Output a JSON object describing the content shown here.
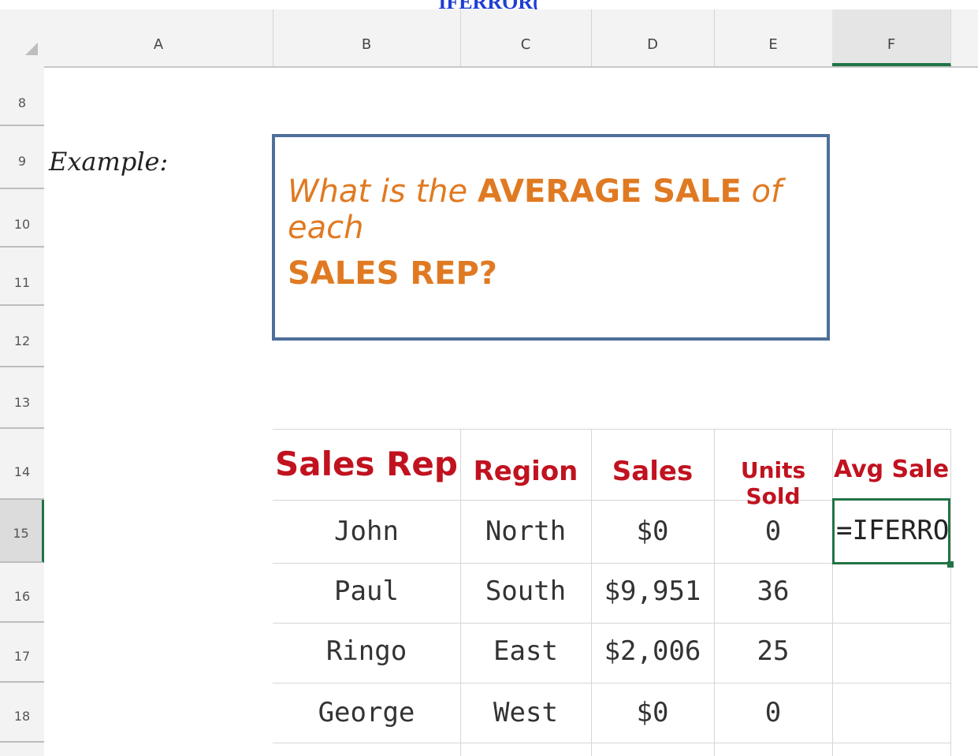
{
  "formula_overlay": "IFERROR(",
  "columns": [
    "A",
    "B",
    "C",
    "D",
    "E",
    "F"
  ],
  "rows": [
    "8",
    "9",
    "10",
    "11",
    "12",
    "13",
    "14",
    "15",
    "16",
    "17",
    "18"
  ],
  "example_label": "Example:",
  "question": {
    "line1_prefix": "What is the ",
    "line1_bold": "AVERAGE SALE",
    "line1_suffix": " of each",
    "line2_bold": "SALES REP?"
  },
  "table": {
    "headers": [
      "Sales Rep",
      "Region",
      "Sales",
      "Units Sold",
      "Avg Sale"
    ],
    "rows": [
      [
        "John",
        "North",
        "$0",
        "0"
      ],
      [
        "Paul",
        "South",
        "$9,951",
        "36"
      ],
      [
        "Ringo",
        "East",
        "$2,006",
        "25"
      ],
      [
        "George",
        "West",
        "$0",
        "0"
      ]
    ],
    "active_cell_value": "=IFERROR("
  },
  "colors": {
    "header_red": "#c1121f",
    "question_orange": "#e07a22",
    "excel_green": "#217346",
    "box_border": "#4f6f9a"
  }
}
